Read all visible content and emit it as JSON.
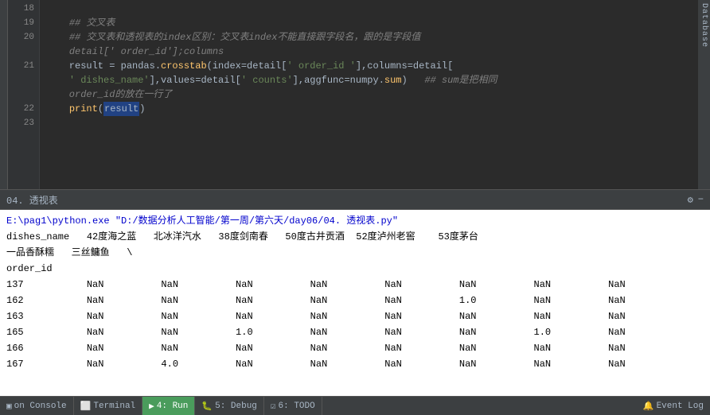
{
  "editor": {
    "lines": [
      {
        "num": "18",
        "code": ""
      },
      {
        "num": "19",
        "code": "    ## 交叉表"
      },
      {
        "num": "20",
        "code": "    ## 交叉表和透视表的index区别：交叉表index不能直接跟字段名，跟的是字段值"
      },
      {
        "num": "",
        "code": "    detail['order_id'];columns"
      },
      {
        "num": "21",
        "code": "    result = pandas.crosstab(index=detail[' order_id '],columns=detail["
      },
      {
        "num": "",
        "code": "    ' dishes_name'],values=detail[' counts'],aggfunc=numpy.sum)   ## sum是把相同"
      },
      {
        "num": "",
        "code": "    order_id的放在一行了"
      },
      {
        "num": "22",
        "code": "    print(result)"
      },
      {
        "num": "23",
        "code": ""
      }
    ]
  },
  "console": {
    "title": "04. 透视表",
    "path": "E:\\pag1\\python.exe \"D:/数据分析人工智能/第一周/第六天/day06/04. 透视表.py\"",
    "header_line1": "dishes_name   42度海之蓝   北冰洋汽水   38度剑南春   50度古井贡酒  52度泸州老窖    53度茅台",
    "header_line2": "一品香酥糯   三丝鳙鱼   \\",
    "order_id_label": "order_id",
    "rows": [
      {
        "id": "137",
        "vals": [
          "NaN",
          "NaN",
          "NaN",
          "NaN",
          "NaN",
          "NaN",
          "NaN",
          "NaN"
        ]
      },
      {
        "id": "162",
        "vals": [
          "NaN",
          "NaN",
          "NaN",
          "NaN",
          "NaN",
          "1.0",
          "NaN",
          "NaN"
        ]
      },
      {
        "id": "163",
        "vals": [
          "NaN",
          "NaN",
          "NaN",
          "NaN",
          "NaN",
          "NaN",
          "NaN",
          "NaN"
        ]
      },
      {
        "id": "165",
        "vals": [
          "NaN",
          "NaN",
          "1.0",
          "NaN",
          "NaN",
          "NaN",
          "1.0",
          "NaN"
        ]
      },
      {
        "id": "166",
        "vals": [
          "NaN",
          "NaN",
          "NaN",
          "NaN",
          "NaN",
          "NaN",
          "NaN",
          "NaN"
        ]
      },
      {
        "id": "167",
        "vals": [
          "NaN",
          "4.0",
          "NaN",
          "NaN",
          "NaN",
          "NaN",
          "NaN",
          "NaN"
        ]
      }
    ]
  },
  "statusbar": {
    "console_label": "on Console",
    "terminal_label": "Terminal",
    "run_label": "4: Run",
    "debug_label": "5: Debug",
    "todo_label": "6: TODO",
    "event_log_label": "Event Log"
  },
  "sidebar": {
    "db_label": "Database"
  }
}
